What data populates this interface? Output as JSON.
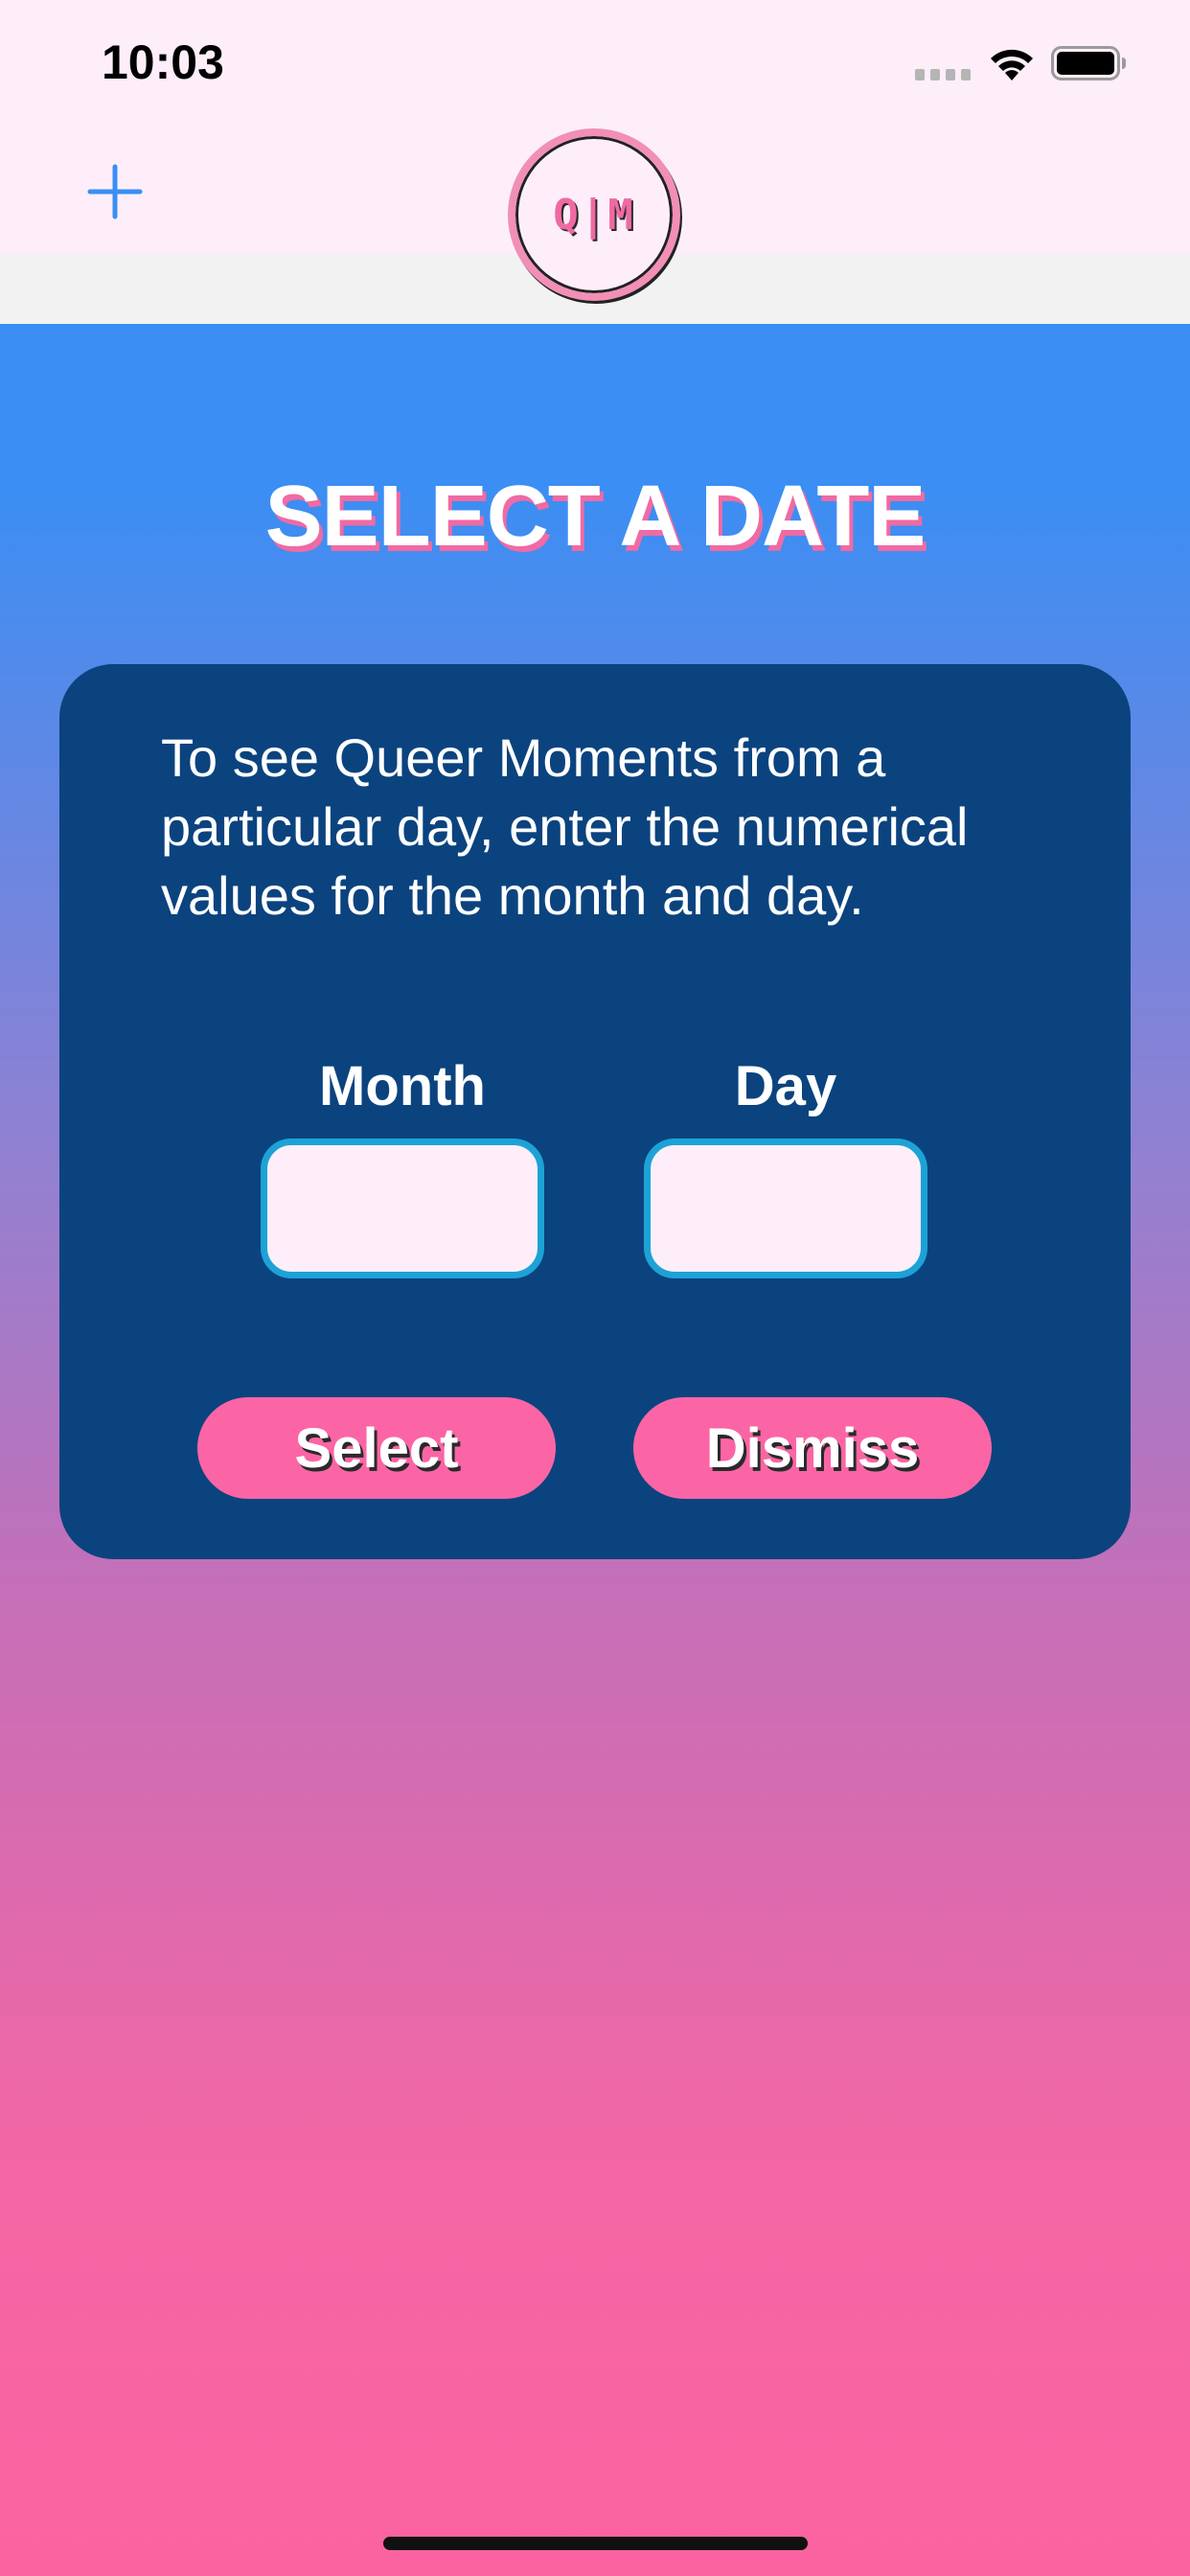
{
  "status_bar": {
    "time": "10:03",
    "icons": [
      "cellular-signal-icon",
      "wifi-icon",
      "battery-icon"
    ]
  },
  "nav_bar": {
    "add_icon": "plus-icon",
    "logo_text": "Q|M"
  },
  "page": {
    "title": "SELECT A DATE",
    "instructions": "To see Queer Moments from a particular day, enter the numerical values for the month and day."
  },
  "form": {
    "month_label": "Month",
    "month_value": "",
    "day_label": "Day",
    "day_value": "",
    "select_label": "Select",
    "dismiss_label": "Dismiss"
  },
  "colors": {
    "accent_blue": "#3a8ef4",
    "card_navy": "#0b437f",
    "brand_pink": "#fb65a5",
    "input_border": "#1da2d6",
    "nav_background": "#fdeefa"
  }
}
